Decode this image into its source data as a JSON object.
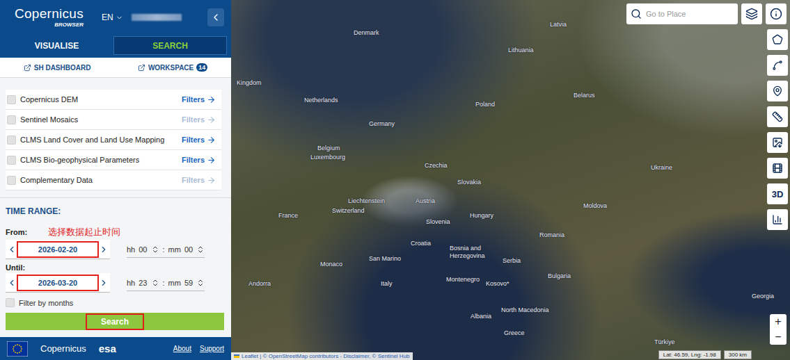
{
  "header": {
    "logo": "Copernicus",
    "subtitle": "BROWSER",
    "language": "EN"
  },
  "tabs": [
    {
      "label": "VISUALISE",
      "selected": false
    },
    {
      "label": "SEARCH",
      "selected": true
    }
  ],
  "links": [
    {
      "label": "SH DASHBOARD",
      "badge": ""
    },
    {
      "label": "WORKSPACE",
      "badge": "14"
    }
  ],
  "collections": [
    {
      "name": "Copernicus DEM",
      "filters": "Filters",
      "enabled": true,
      "checked": false
    },
    {
      "name": "Sentinel Mosaics",
      "filters": "Filters",
      "enabled": false,
      "checked": false
    },
    {
      "name": "CLMS Land Cover and Land Use Mapping",
      "filters": "Filters",
      "enabled": true,
      "checked": false
    },
    {
      "name": "CLMS Bio-geophysical Parameters",
      "filters": "Filters",
      "enabled": true,
      "checked": false
    },
    {
      "name": "Complementary Data",
      "filters": "Filters",
      "enabled": false,
      "checked": false
    }
  ],
  "time_range": {
    "title": "TIME RANGE:",
    "note": "选择数据起止时间",
    "fields": [
      {
        "label": "From:",
        "date": "2026-02-20",
        "hh_label": "hh",
        "hh": "00",
        "separator": ":",
        "mm_label": "mm",
        "mm": "00",
        "highlighted": true
      },
      {
        "label": "Until:",
        "date": "2026-03-20",
        "hh_label": "hh",
        "hh": "23",
        "separator": ":",
        "mm_label": "mm",
        "mm": "59",
        "highlighted": true
      }
    ],
    "filter_by_months": {
      "label": "Filter by months",
      "checked": false
    }
  },
  "search_button": {
    "label": "Search",
    "highlighted": true
  },
  "footer": {
    "copernicus": "Copernicus",
    "esa": "esa",
    "links": [
      "About",
      "Support"
    ]
  },
  "map": {
    "search_placeholder": "Go to Place",
    "tool_3d": "3D",
    "zoom_in": "+",
    "zoom_out": "−",
    "attribution": "Leaflet | © OpenStreetMap contributors - Disclaimer, © Sentinel Hub",
    "coordinates": "Lat: 46.59, Lng: -1.98",
    "scale": "300 km",
    "labels": [
      "Denmark",
      "Latvia",
      "Lithuania",
      "Kingdom",
      "Netherlands",
      "Poland",
      "Belarus",
      "Germany",
      "Belgium",
      "Luxembourg",
      "Czechia",
      "Ukraine",
      "Slovakia",
      "Liechtenstein",
      "Austria",
      "Moldova",
      "France",
      "Switzerland",
      "Hungary",
      "Slovenia",
      "Romania",
      "Croatia",
      "Bosnia and Herzegovina",
      "Serbia",
      "Monaco",
      "San Marino",
      "Andorra",
      "Italy",
      "Montenegro",
      "Kosovo*",
      "Bulgaria",
      "North Macedonia",
      "Albania",
      "Greece",
      "Türkiye",
      "Georgia"
    ]
  }
}
